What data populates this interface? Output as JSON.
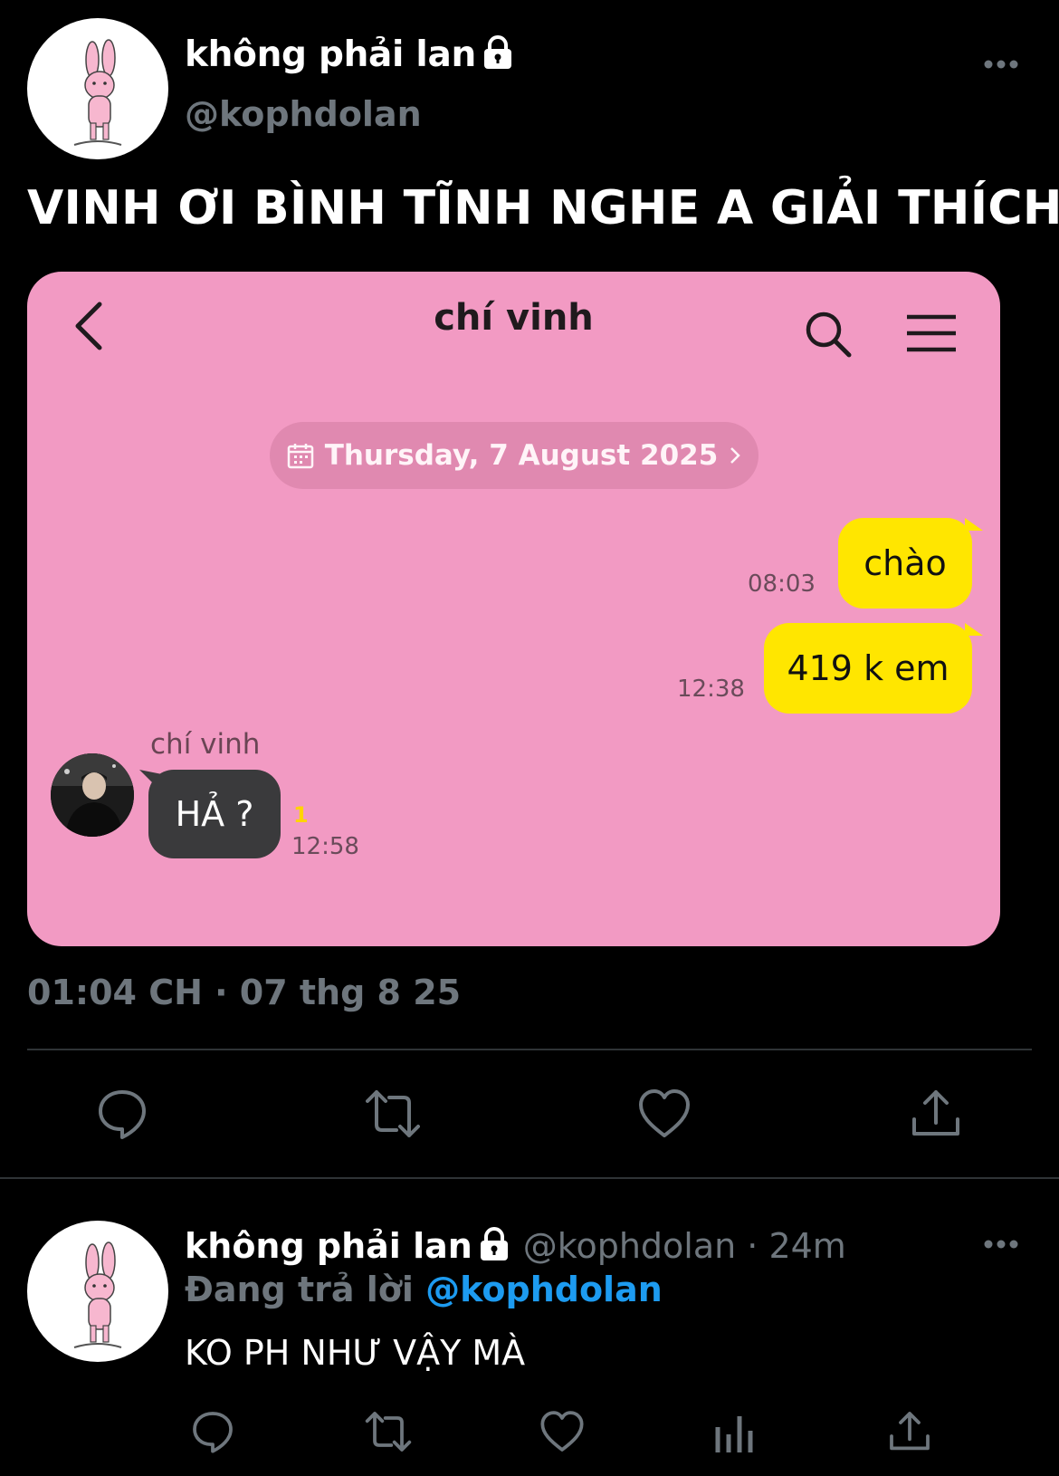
{
  "tweet": {
    "display_name": "không phải lan",
    "handle": "@kophdolan",
    "text": "VINH ƠI BÌNH TĨNH NGHE A GIẢI THÍCH",
    "timestamp": "01:04 CH · 07 thg 8 25",
    "icons": {
      "lock": "lock-icon",
      "more": "more-icon",
      "reply": "reply-icon",
      "retweet": "retweet-icon",
      "like": "like-icon",
      "share": "share-icon"
    }
  },
  "chat": {
    "title": "chí vinh",
    "date_pill": "Thursday, 7 August 2025",
    "messages_out": [
      {
        "text": "chào",
        "time": "08:03"
      },
      {
        "text": "419 k em",
        "time": "12:38"
      }
    ],
    "message_in": {
      "sender": "chí vinh",
      "text": "HẢ ?",
      "unread": "1",
      "time": "12:58"
    },
    "colors": {
      "background": "#f29ac3",
      "outgoing_bubble": "#ffe600",
      "incoming_bubble": "#3a3a3c",
      "unread": "#ffd400"
    }
  },
  "reply": {
    "display_name": "không phải lan",
    "meta": "@kophdolan · 24m",
    "replying_prefix": "Đang trả lời",
    "replying_mention": "@kophdolan",
    "text": "KO PH NHƯ VẬY MÀ"
  },
  "colors": {
    "background": "#000000",
    "secondary_text": "#6e767d",
    "link": "#1d9bf0",
    "divider": "#2f3336"
  }
}
